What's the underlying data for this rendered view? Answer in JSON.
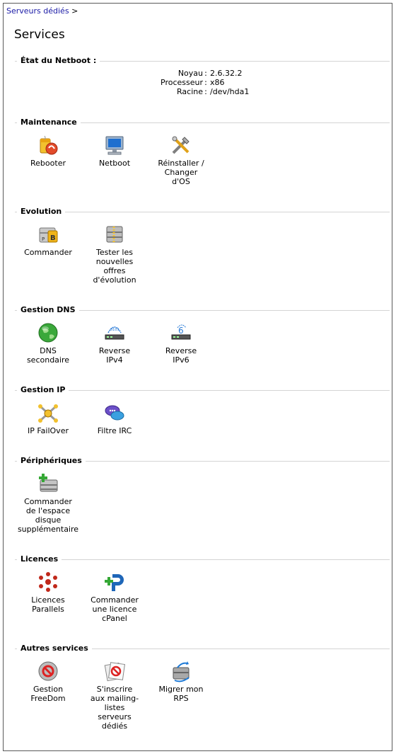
{
  "breadcrumb": {
    "link": "Serveurs dédiés",
    "sep": ">"
  },
  "page_title": "Services",
  "netboot": {
    "title": "État du Netboot :",
    "rows": [
      {
        "label": "Noyau",
        "value": "2.6.32.2"
      },
      {
        "label": "Processeur",
        "value": "x86"
      },
      {
        "label": "Racine",
        "value": "/dev/hda1"
      }
    ]
  },
  "sections": {
    "maintenance": {
      "title": "Maintenance",
      "items": [
        {
          "label": "Rebooter",
          "icon": "reboot-icon"
        },
        {
          "label": "Netboot",
          "icon": "monitor-icon"
        },
        {
          "label": "Réinstaller /\nChanger\nd'OS",
          "icon": "tools-icon"
        }
      ]
    },
    "evolution": {
      "title": "Evolution",
      "items": [
        {
          "label": "Commander",
          "icon": "server-order-icon"
        },
        {
          "label": "Tester les\nnouvelles\noffres\nd'évolution",
          "icon": "server-test-icon"
        }
      ]
    },
    "dns": {
      "title": "Gestion DNS",
      "items": [
        {
          "label": "DNS\nsecondaire",
          "icon": "globe-icon"
        },
        {
          "label": "Reverse\nIPv4",
          "icon": "reverse-ipv4-icon"
        },
        {
          "label": "Reverse\nIPv6",
          "icon": "reverse-ipv6-icon"
        }
      ]
    },
    "ip": {
      "title": "Gestion IP",
      "items": [
        {
          "label": "IP FailOver",
          "icon": "failover-icon"
        },
        {
          "label": "Filtre IRC",
          "icon": "chat-icon"
        }
      ]
    },
    "peripheriques": {
      "title": "Périphériques",
      "items": [
        {
          "label": "Commander\nde l'espace\ndisque\nsupplémentaire",
          "icon": "disk-add-icon"
        }
      ]
    },
    "licences": {
      "title": "Licences",
      "items": [
        {
          "label": "Licences\nParallels",
          "icon": "parallels-icon"
        },
        {
          "label": "Commander\nune licence\ncPanel",
          "icon": "cpanel-icon"
        }
      ]
    },
    "autres": {
      "title": "Autres services",
      "items": [
        {
          "label": "Gestion\nFreeDom",
          "icon": "freedom-icon"
        },
        {
          "label": "S'inscrire\naux mailing-\nlistes\nserveurs\ndédiés",
          "icon": "mailing-icon"
        },
        {
          "label": "Migrer mon\nRPS",
          "icon": "migrate-icon"
        }
      ]
    }
  }
}
